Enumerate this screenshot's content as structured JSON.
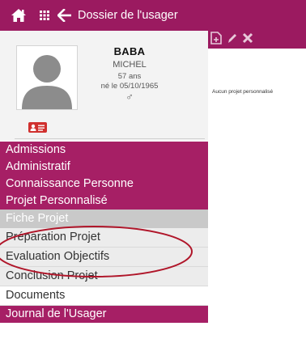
{
  "topbar": {
    "title": "Dossier de l'usager",
    "home_icon": "home-icon",
    "apps_icon": "grid-icon",
    "back_icon": "arrow-left-icon",
    "color": "#9b1a60"
  },
  "patient": {
    "last_name": "BABA",
    "first_name": "MICHEL",
    "age": "57 ans",
    "birth": "né le 05/10/1965",
    "sex_symbol": "♂",
    "card_icon": "id-card-icon"
  },
  "menu": {
    "admissions": "Admissions",
    "administratif": "Administratif",
    "connaissance": "Connaissance Personne",
    "projet_perso": "Projet Personnalisé",
    "fiche_projet": "Fiche Projet",
    "preparation": "Préparation Projet",
    "evaluation": "Evaluation Objectifs",
    "conclusion": "Conclusion Projet",
    "documents": "Documents",
    "journal": "Journal de l'Usager"
  },
  "toolbar": {
    "icons": [
      "add-document-icon",
      "edit-icon",
      "delete-icon"
    ]
  },
  "main": {
    "empty_message": "Aucun projet personnalisé"
  },
  "colors": {
    "accent": "#a61f65",
    "selected": "#c9c9c9",
    "annotation": "#b0162a"
  }
}
